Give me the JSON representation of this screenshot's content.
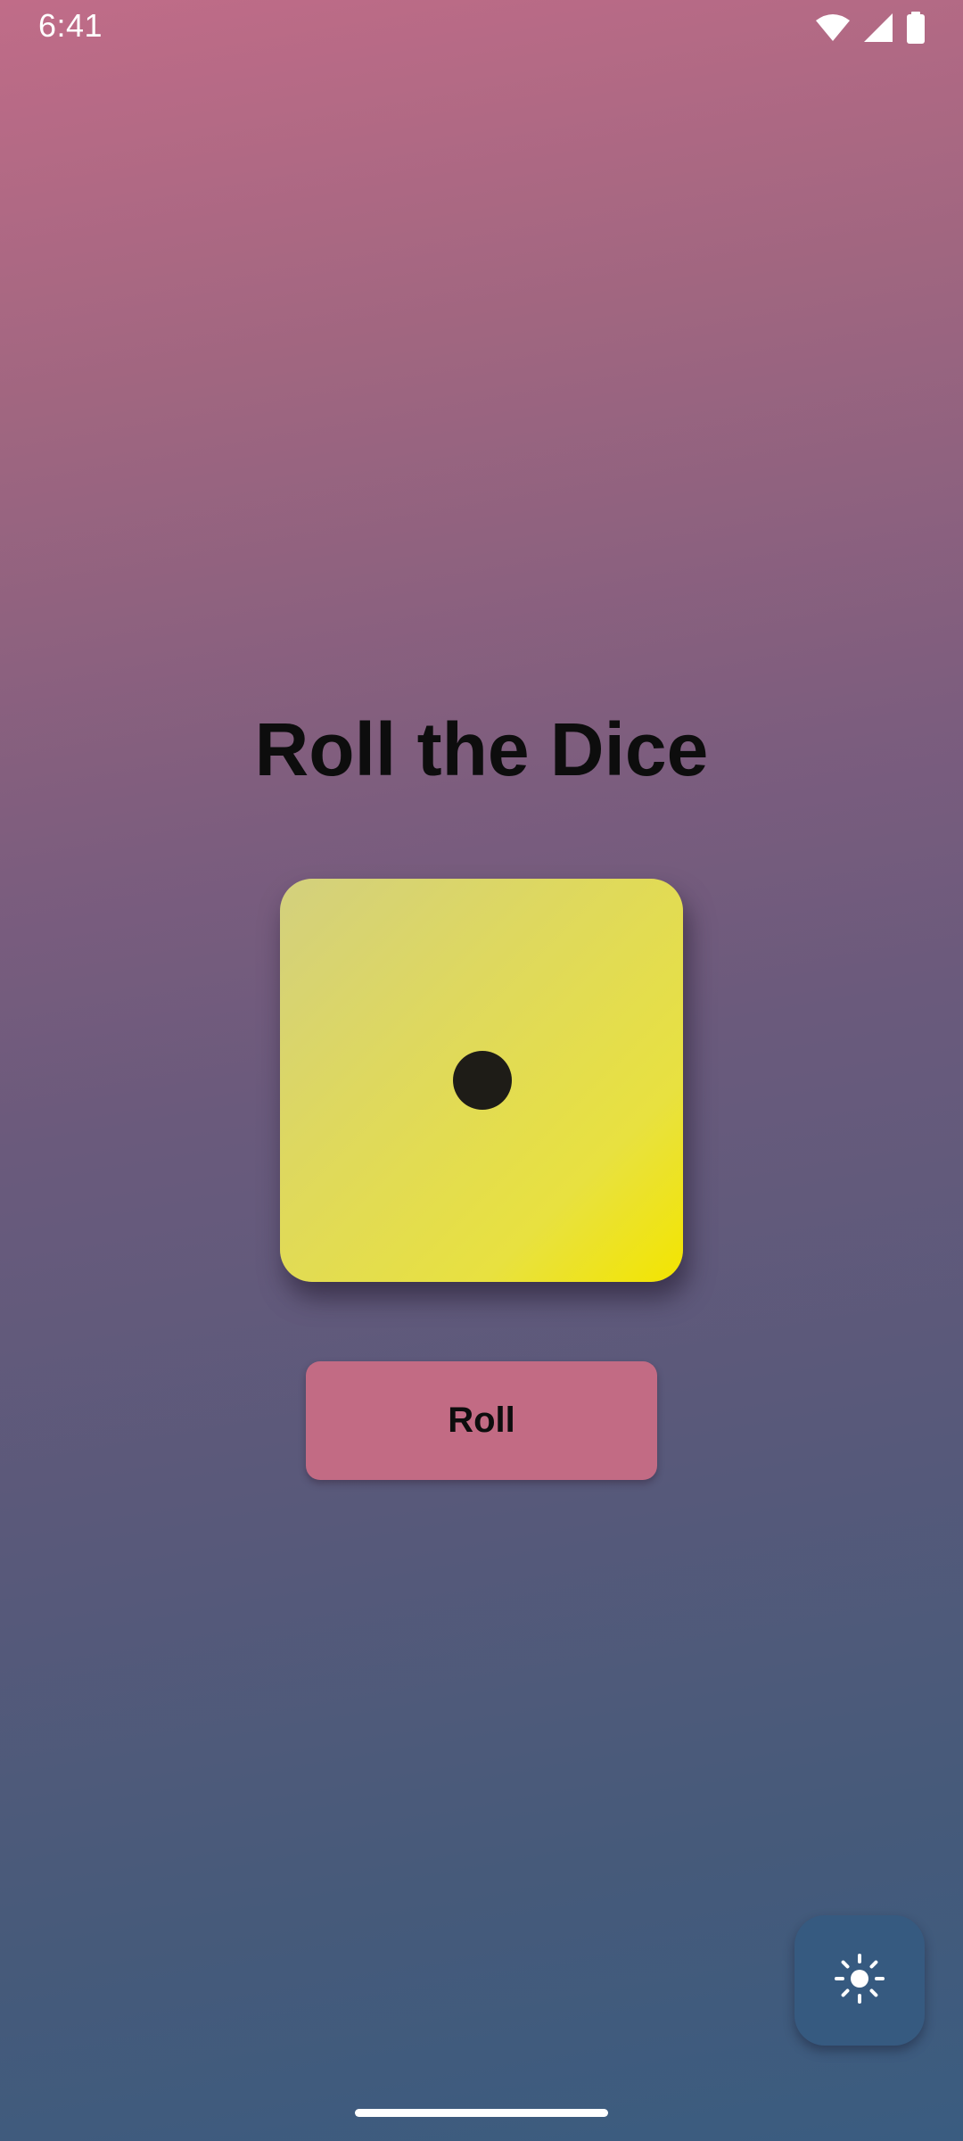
{
  "status_bar": {
    "time": "6:41",
    "icons": [
      "wifi-icon",
      "cellular-signal-icon",
      "battery-icon"
    ]
  },
  "main": {
    "title": "Roll the Dice",
    "dice": {
      "face_value": 1,
      "color_light": "#d3d07e",
      "color_strong": "#f3e500",
      "pip_color": "#1e1c17"
    },
    "roll_button": {
      "label": "Roll",
      "color": "#c26b84"
    }
  },
  "fab": {
    "icon": "sun-icon",
    "purpose": "theme toggle",
    "color": "#365a80"
  },
  "theme": {
    "gradient_top": "#c06c88",
    "gradient_bottom": "#3a5c80"
  }
}
